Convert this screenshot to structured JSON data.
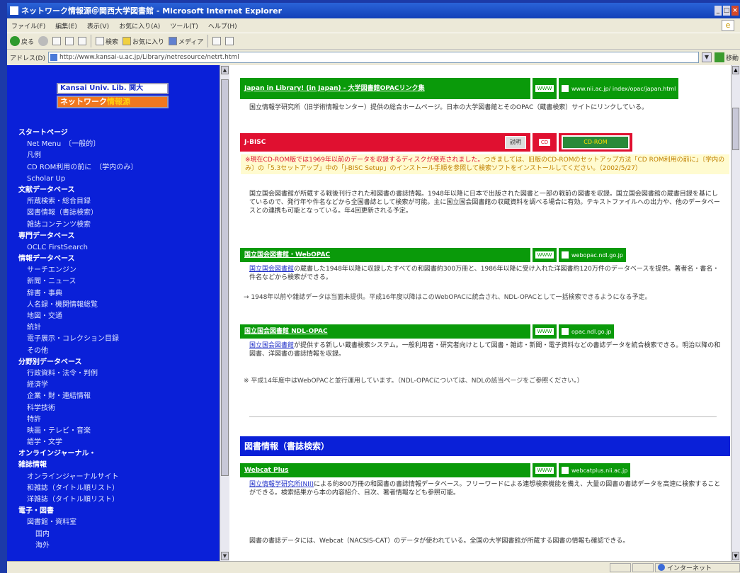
{
  "window": {
    "title": "ネットワーク情報源＠関西大学図書館 - Microsoft Internet Explorer"
  },
  "menu": [
    "ファイル(F)",
    "編集(E)",
    "表示(V)",
    "お気に入り(A)",
    "ツール(T)",
    "ヘルプ(H)"
  ],
  "toolbar": {
    "back": "戻る",
    "search": "検索",
    "favorites": "お気に入り",
    "media": "メディア"
  },
  "address": {
    "label": "アドレス(D)",
    "url": "http://www.kansai-u.ac.jp/Library/netresource/netrt.html",
    "go": "移動"
  },
  "sidebar": {
    "logo_top": "Kansai Univ. Lib. 関大",
    "logo_bottom_a": "ネットワーク",
    "logo_bottom_b": "情報源",
    "items": [
      {
        "label": "スタートページ",
        "level": "cat"
      },
      {
        "label": "Net Menu　〔一般的〕",
        "level": "l1"
      },
      {
        "label": "凡例",
        "level": "l1"
      },
      {
        "label": "CD ROM利用の前に　〔学内のみ〕",
        "level": "l1"
      },
      {
        "label": "Scholar Up",
        "level": "l1"
      },
      {
        "label": "文献データベース",
        "level": "cat"
      },
      {
        "label": "所蔵検索・総合目録",
        "level": "l1"
      },
      {
        "label": "図書情報（書誌検索）",
        "level": "l1"
      },
      {
        "label": "雑誌コンテンツ検索",
        "level": "l1"
      },
      {
        "label": "専門データベース",
        "level": "cat"
      },
      {
        "label": "OCLC FirstSearch",
        "level": "l1"
      },
      {
        "label": "情報データベース",
        "level": "cat"
      },
      {
        "label": "サーチエンジン",
        "level": "l1"
      },
      {
        "label": "新聞・ニュース",
        "level": "l1"
      },
      {
        "label": "辞書・事典",
        "level": "l1"
      },
      {
        "label": "人名録・機関情報総覧",
        "level": "l1"
      },
      {
        "label": "地図・交通",
        "level": "l1"
      },
      {
        "label": "統計",
        "level": "l1"
      },
      {
        "label": "電子展示・コレクション目録",
        "level": "l1"
      },
      {
        "label": "その他",
        "level": "l1"
      },
      {
        "label": "分野別データベース",
        "level": "cat"
      },
      {
        "label": "行政資料・法令・判例",
        "level": "l1"
      },
      {
        "label": "経済学",
        "level": "l1"
      },
      {
        "label": "企業・財・連結情報",
        "level": "l1"
      },
      {
        "label": "科学技術",
        "level": "l1"
      },
      {
        "label": "特許",
        "level": "l1"
      },
      {
        "label": "映画・テレビ・音楽",
        "level": "l1"
      },
      {
        "label": "語学・文学",
        "level": "l1"
      },
      {
        "label": "オンラインジャーナル・",
        "level": "cat"
      },
      {
        "label": "雑誌情報",
        "level": "cat"
      },
      {
        "label": "オンラインジャーナルサイト",
        "level": "l1"
      },
      {
        "label": "和雑誌（タイトル順リスト）",
        "level": "l1"
      },
      {
        "label": "洋雑誌（タイトル順リスト）",
        "level": "l1"
      },
      {
        "label": "電子・図書",
        "level": "cat"
      },
      {
        "label": "図書館・資料室",
        "level": "l1"
      },
      {
        "label": "国内",
        "level": "l2"
      },
      {
        "label": "海外",
        "level": "l2"
      }
    ]
  },
  "entries": [
    {
      "name": "Japan in Library! (in Japan) - 大学図書館OPACリンク集",
      "tag": "WWW",
      "url": "www.nii.ac.jp/\nindex/opac/japan.html",
      "desc": "国立情報学研究所（旧学術情報センター）提供の総合ホームページ。日本の大学図書館とそのOPAC（蔵書検索）サイトにリンクしている。"
    },
    {
      "name": "J-BISC",
      "tag": "CD",
      "button": "説明",
      "badge": "CD-ROM",
      "warn_red": "※現在CD-ROM版では1969年以前のデータを収録するディスクが発売されました。",
      "warn_rest": "つきましては、旧版のCD-ROMのセットアップ方法「CD ROM利用の前に」〔学内のみ〕の「5.3セットアップ」中の「J-BISC Setup」のインストール手順を参照して検索ソフトをインストールしてください。（2002/5/27）",
      "desc": "国立国会図書館が所蔵する戦後刊行された和図書の書誌情報。1948年以降に日本で出版された図書と一部の戦前の図書を収録。国立国会図書館の蔵書目録を基にしているので、発行年や件名などから全国書誌として検索が可能。主に国立国会図書館の収蔵資料を調べる場合に有効。テキストファイルへの出力や、他のデータベースとの連携も可能となっている。年4回更新される予定。"
    },
    {
      "name": "国立国会図書館・WebOPAC",
      "tag": "WWW",
      "url": "webopac.ndl.go.jp",
      "desc_link": "国立国会図書館",
      "desc": "の蔵書した1948年以降に収録したすべての和図書約300万冊と、1986年以降に受け入れた洋図書約120万件のデータベースを提供。著者名・書名・件名などから検索ができる。",
      "note": "→ 1948年以前や雑誌データは当面未提供。平成16年度以降はこのWebOPACに統合され、NDL-OPACとして一括検索できるようになる予定。"
    },
    {
      "name": "国立国会図書館 NDL-OPAC",
      "tag": "WWW",
      "url": "opac.ndl.go.jp",
      "desc_link": "国立国会図書館",
      "desc": "が提供する新しい蔵書検索システム。一般利用者・研究者向けとして図書・雑誌・新聞・電子資料などの書誌データを統合検索できる。明治以降の和図書、洋図書の書誌情報を収録。",
      "note": "※ 平成14年度中はWebOPACと並行運用しています。（NDL-OPACについては、NDLの該当ページをご参照ください。）"
    }
  ],
  "section_title": "図書情報（書誌検索）",
  "entry5": {
    "name": "Webcat Plus",
    "tag": "WWW",
    "url": "webcatplus.nii.ac.jp",
    "desc_link": "国立情報学研究所(NII)",
    "desc": "による約800万冊の和図書の書誌情報データベース。フリーワードによる連想検索機能を備え、大量の図書の書誌データを高速に検索することができる。検索結果から本の内容紹介、目次、著者情報なども参照可能。",
    "desc2": "図書の書誌データには、Webcat（NACSIS-CAT）のデータが使われている。全国の大学図書館が所蔵する図書の情報も確認できる。"
  },
  "status": {
    "left": "",
    "zone": "インターネット"
  }
}
